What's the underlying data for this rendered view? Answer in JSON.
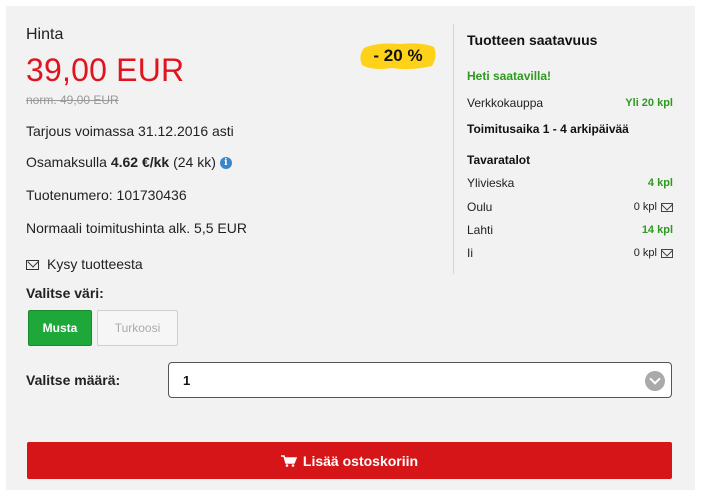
{
  "price": {
    "label": "Hinta",
    "current": "39,00 EUR",
    "normal": "norm. 49,00 EUR",
    "discount_badge": "- 20 %"
  },
  "details": {
    "offer_valid": "Tarjous voimassa 31.12.2016 asti",
    "installment_prefix": "Osamaksulla ",
    "installment_amount": "4.62 €/kk",
    "installment_suffix": " (24 kk)",
    "product_number": "Tuotenumero: 101730436",
    "delivery_price": "Normaali toimitushinta alk. 5,5 EUR",
    "ask_link": "Kysy tuotteesta"
  },
  "availability": {
    "title": "Tuotteen saatavuus",
    "status": "Heti saatavilla!",
    "online_label": "Verkkokauppa",
    "online_qty": "Yli 20 kpl",
    "delivery_time": "Toimitusaika 1 - 4 arkipäivää",
    "stores_title": "Tavaratalot",
    "stores": [
      {
        "name": "Ylivieska",
        "qty": "4 kpl"
      },
      {
        "name": "Oulu",
        "qty": "0 kpl"
      },
      {
        "name": "Lahti",
        "qty": "14 kpl"
      },
      {
        "name": "Ii",
        "qty": "0 kpl"
      }
    ]
  },
  "color_select": {
    "label": "Valitse väri:",
    "options": [
      "Musta",
      "Turkoosi"
    ],
    "selected": "Musta"
  },
  "quantity": {
    "label": "Valitse määrä:",
    "value": "1"
  },
  "cart_button": {
    "label": "Lisää ostoskoriin"
  },
  "colors": {
    "price_red": "#e0141e",
    "in_stock_green": "#2e9a1f",
    "selected_green": "#1fa83a",
    "cart_red": "#d51517",
    "badge_yellow": "#ffd21a"
  }
}
